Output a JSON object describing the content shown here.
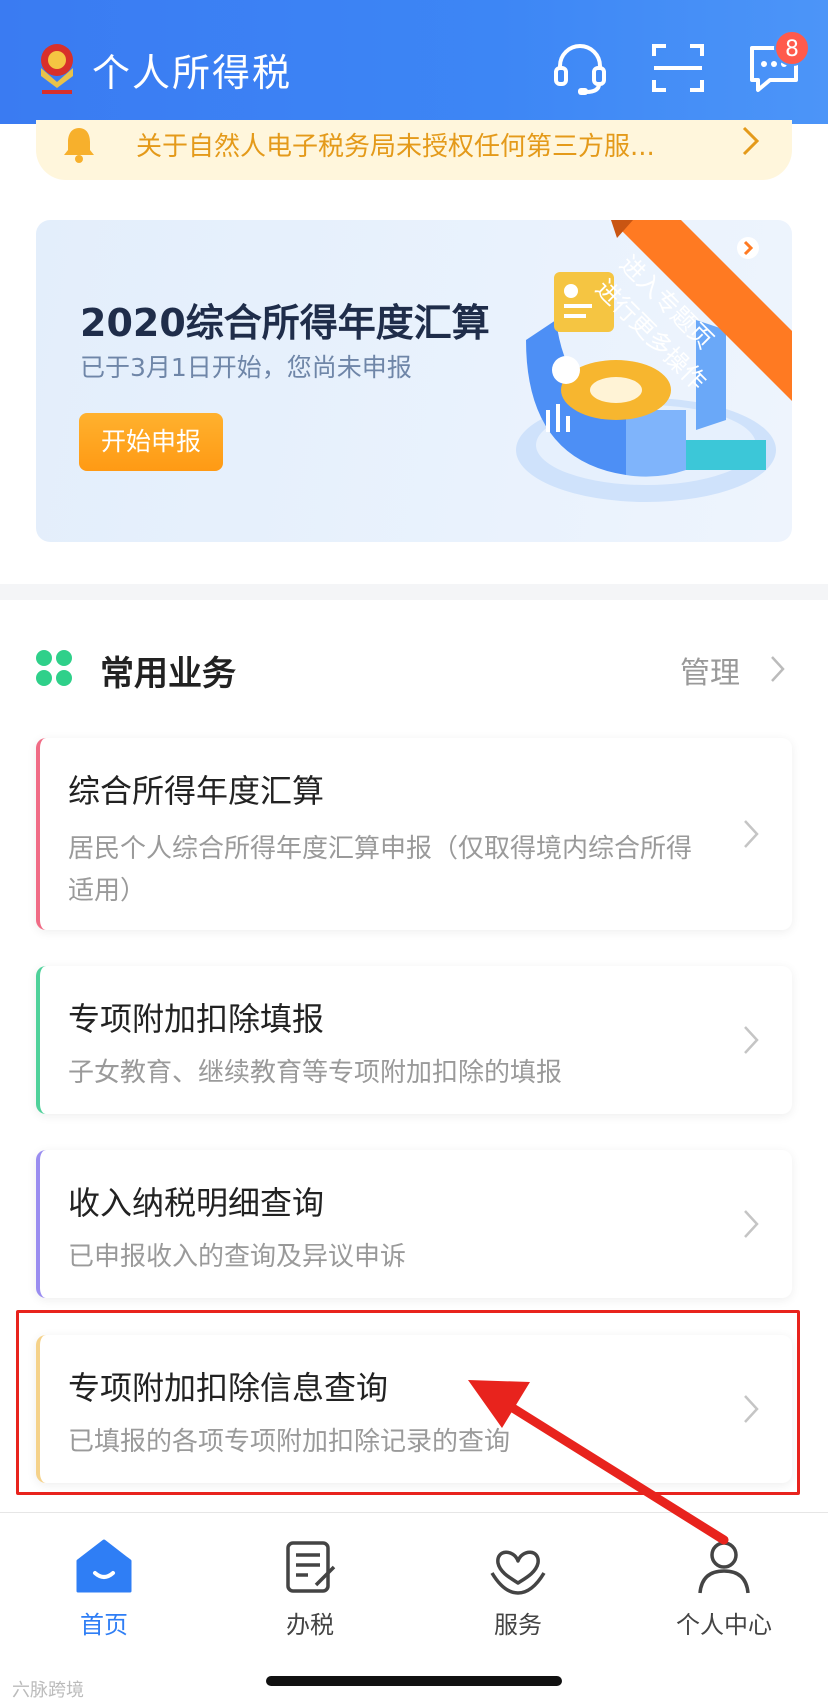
{
  "header": {
    "title": "个人所得税",
    "message_badge": "8",
    "icons": [
      "customer-service-icon",
      "scan-icon",
      "message-icon"
    ]
  },
  "notice": {
    "text": "关于自然人电子税务局未授权任何第三方服..."
  },
  "banner": {
    "title": "2020综合所得年度汇算",
    "subtitle": "已于3月1日开始，您尚未申报",
    "button": "开始申报",
    "ribbon_line1": "进入专题页",
    "ribbon_line2": "进行更多操作"
  },
  "section": {
    "title": "常用业务",
    "manage": "管理"
  },
  "cards": [
    {
      "title": "综合所得年度汇算",
      "desc": "居民个人综合所得年度汇算申报（仅取得境内综合所得适用）"
    },
    {
      "title": "专项附加扣除填报",
      "desc": "子女教育、继续教育等专项附加扣除的填报"
    },
    {
      "title": "收入纳税明细查询",
      "desc": "已申报收入的查询及异议申诉"
    },
    {
      "title": "专项附加扣除信息查询",
      "desc": "已填报的各项专项附加扣除记录的查询"
    }
  ],
  "tabbar": [
    {
      "label": "首页",
      "icon": "home-icon"
    },
    {
      "label": "办税",
      "icon": "tax-form-icon"
    },
    {
      "label": "服务",
      "icon": "service-heart-icon"
    },
    {
      "label": "个人中心",
      "icon": "user-icon"
    }
  ],
  "watermark": "六脉跨境",
  "colors": {
    "primary": "#3a7bf2",
    "notice_text": "#e49a1a",
    "button_orange": "#ff9a14",
    "highlight_red": "#e8231d"
  }
}
